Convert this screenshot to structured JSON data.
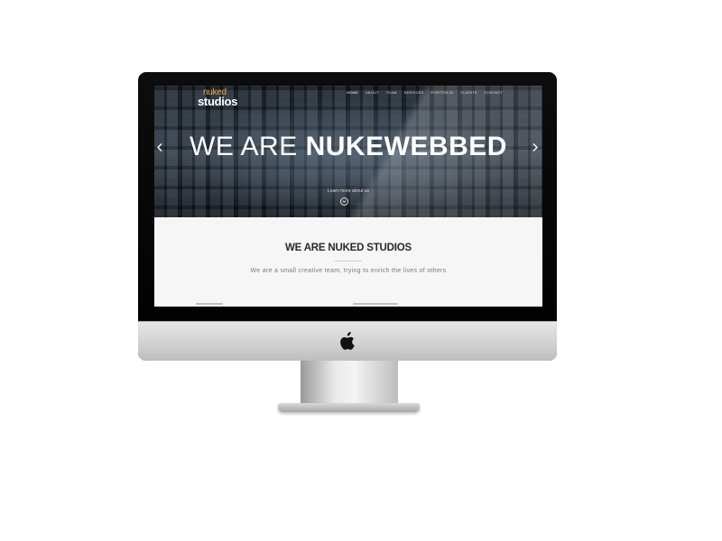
{
  "site": {
    "logo_top": "nuked",
    "logo_bottom": "studios"
  },
  "nav": {
    "items": [
      "HOME",
      "ABOUT",
      "TEAM",
      "SERVICES",
      "PORTFOLIO",
      "CLIENTS",
      "CONTACT"
    ],
    "active": "HOME"
  },
  "hero": {
    "title_light": "WE ARE",
    "title_bold": "NUKEWEBBED",
    "learn_more": "Learn more about us",
    "prev_icon": "chevron-left-icon",
    "next_icon": "chevron-right-icon",
    "scroll_icon": "chevron-down-circle-icon"
  },
  "content": {
    "title": "WE ARE NUKED STUDIOS",
    "subtitle": "We are a small creative team, trying to enrich the lives of others"
  },
  "device": {
    "brand_icon": "apple-logo-icon"
  },
  "colors": {
    "accent": "#e8a64a",
    "frame": "#000000",
    "content_bg": "#f6f6f6"
  }
}
